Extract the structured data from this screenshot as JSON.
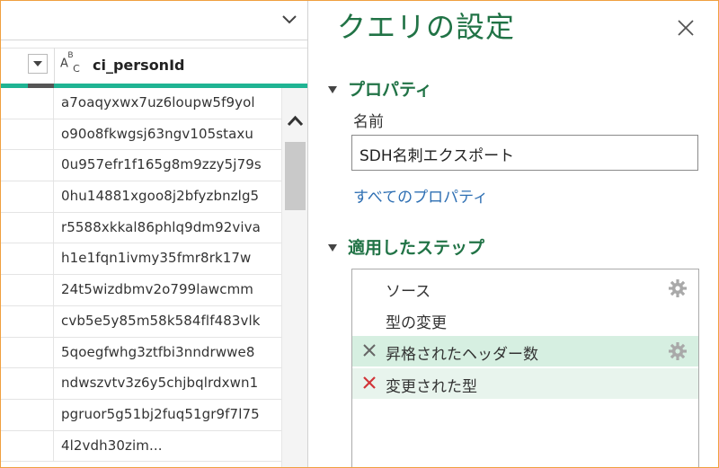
{
  "grid": {
    "column_type_icon": "ABC",
    "column_name": "ci_personId",
    "rows": [
      "a7oaqyxwx7uz6loupw5f9yol",
      "o90o8fkwgsj63ngv105staxu",
      "0u957efr1f165g8m9zzy5j79s",
      "0hu14881xgoo8j2bfyzbnzlg5",
      "r5588xkkal86phlq9dm92viva",
      "h1e1fqn1ivmy35fmr8rk17w",
      "24t5wizdbmv2o799lawcmm",
      "cvb5e5y85m58k584flf483vlk",
      "5qoegfwhg3ztfbi3nndrwwe8",
      "ndwszvtv3z6y5chjbqlrdxwn1",
      "pgruor5g51bj2fuq51gr9f7l75",
      "4l2vdh30zim..."
    ],
    "accent_color": "#1fb493"
  },
  "settings": {
    "title": "クエリの設定",
    "properties_heading": "プロパティ",
    "name_label": "名前",
    "name_value": "SDH名刺エクスポート",
    "all_properties_link": "すべてのプロパティ",
    "applied_steps_heading": "適用したステップ",
    "steps": [
      {
        "label": "ソース",
        "has_gear": true,
        "has_delete": false
      },
      {
        "label": "型の変更",
        "has_gear": false,
        "has_delete": false
      },
      {
        "label": "昇格されたヘッダー数",
        "has_gear": true,
        "has_delete": true,
        "delete_style": "gray"
      },
      {
        "label": "変更された型",
        "has_gear": false,
        "has_delete": true,
        "delete_style": "red"
      }
    ],
    "heading_color": "#217346",
    "link_color": "#2e6fb3"
  },
  "icons": {
    "formula_expand": "chevron-down-icon",
    "column_filter": "dropdown-arrow-icon",
    "scroll_up": "chevron-up-icon",
    "close": "close-icon",
    "step_settings": "gear-icon",
    "step_delete": "x-icon"
  }
}
